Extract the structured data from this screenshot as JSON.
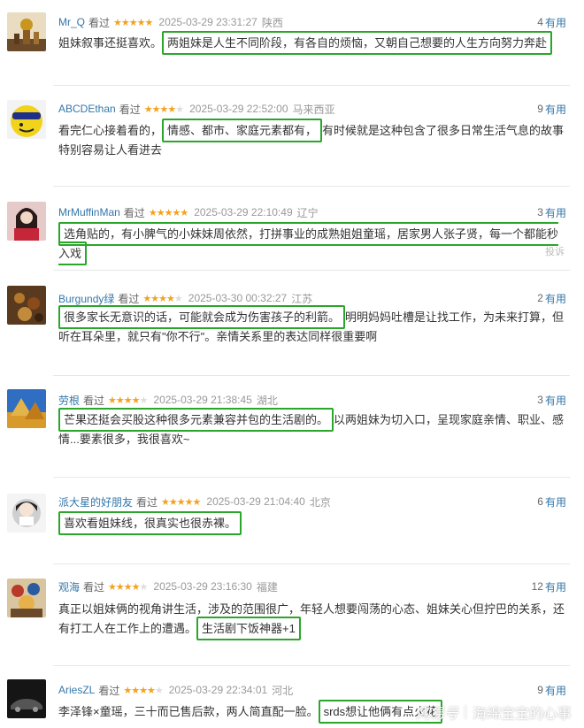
{
  "status_label": "看过",
  "useful_label": "有用",
  "report_label": "投诉",
  "watermark": {
    "brand": "网易号",
    "sep": "|",
    "account": "海绵宝宝的心事"
  },
  "comments": [
    {
      "user": "Mr_Q",
      "stars": 5,
      "time": "2025-03-29 23:31:27",
      "loc": "陕西",
      "votes": "4",
      "pre": "姐妹叙事还挺喜欢。",
      "hl": "两姐妹是人生不同阶段，有各自的烦恼，又朝自己想要的人生方向努力奔赴",
      "post": ""
    },
    {
      "user": "ABCDEthan",
      "stars": 4,
      "time": "2025-03-29 22:52:00",
      "loc": "马来西亚",
      "votes": "9",
      "pre": "看完仁心接着看的，",
      "hl": "情感、都市、家庭元素都有，",
      "post": "有时候就是这种包含了很多日常生活气息的故事特别容易让人看进去"
    },
    {
      "user": "MrMuffinMan",
      "stars": 5,
      "time": "2025-03-29 22:10:49",
      "loc": "辽宁",
      "votes": "3",
      "pre": "",
      "hl": "选角贴的，有小脾气的小妹妹周依然，打拼事业的成熟姐姐童瑶，居家男人张子贤，每一个都能秒入戏",
      "post": ""
    },
    {
      "user": "Burgundy绿",
      "stars": 4,
      "time": "2025-03-30 00:32:27",
      "loc": "江苏",
      "votes": "2",
      "pre": "",
      "hl": "很多家长无意识的话，可能就会成为伤害孩子的利箭。",
      "post": "明明妈妈吐槽是让找工作，为未来打算，但听在耳朵里，就只有\"你不行\"。亲情关系里的表达同样很重要啊"
    },
    {
      "user": "劳根",
      "stars": 4,
      "time": "2025-03-29 21:38:45",
      "loc": "湖北",
      "votes": "3",
      "pre": "",
      "hl": "芒果还挺会买股这种很多元素兼容并包的生活剧的。",
      "post": "以两姐妹为切入口，呈现家庭亲情、职业、感情...要素很多，我很喜欢~"
    },
    {
      "user": "派大星的好朋友",
      "stars": 5,
      "time": "2025-03-29 21:04:40",
      "loc": "北京",
      "votes": "6",
      "pre": "",
      "hl": "喜欢看姐妹线，很真实也很赤裸。",
      "post": ""
    },
    {
      "user": "观海",
      "stars": 4,
      "time": "2025-03-29 23:16:30",
      "loc": "福建",
      "votes": "12",
      "pre": "真正以姐妹俩的视角讲生活，涉及的范围很广，年轻人想要闯荡的心态、姐妹关心但拧巴的关系，还有打工人在工作上的遭遇。",
      "hl": "生活剧下饭神器+1",
      "post": ""
    },
    {
      "user": "AriesZL",
      "stars": 4,
      "time": "2025-03-29 22:34:01",
      "loc": "河北",
      "votes": "9",
      "pre": "李泽锋×童瑶，三十而已售后款，两人简直配一脸。",
      "hl": "srds想让他俩有点火花",
      "post": ""
    }
  ]
}
